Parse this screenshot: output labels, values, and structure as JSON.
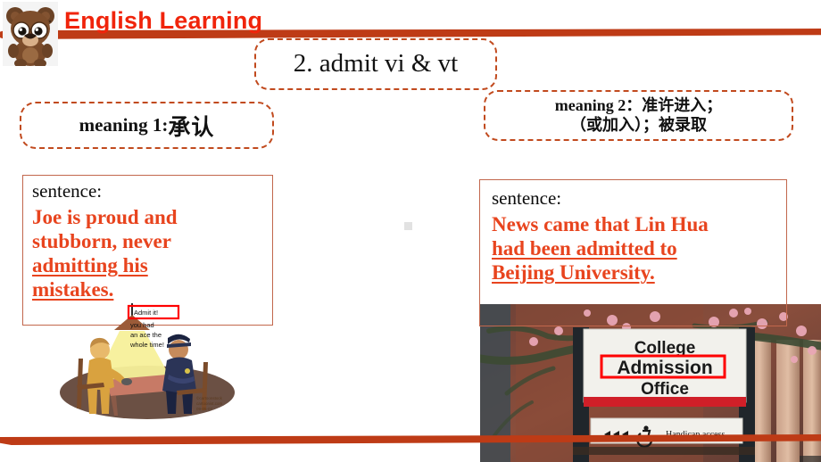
{
  "brand": {
    "title": "English Learning",
    "mascot_icon": "bear-mascot-icon"
  },
  "title_box": {
    "text": "2. admit vi & vt"
  },
  "meaning1_box": {
    "label": "meaning 1: ",
    "chinese": "承认"
  },
  "meaning2_box": {
    "line1": "meaning 2：准许进入；",
    "line2": "（或加入）；被录取"
  },
  "sentence_left": {
    "label": "sentence:",
    "line1": "Joe is proud and",
    "line2": "stubborn, never",
    "line3_underlined": "admitting his",
    "line4_underlined": "mistakes."
  },
  "sentence_right": {
    "label": "sentence:",
    "line1": "News came that Lin Hua",
    "line2_underlined": "had  been admitted to",
    "line3_underlined": "Beijing University."
  },
  "cartoon": {
    "name": "interrogation-cartoon",
    "caption_line1": "Admit it!",
    "caption_line2": "you had",
    "caption_line3": "an ace the",
    "caption_line4": "whole time!",
    "credit": "cartoon credit"
  },
  "photo": {
    "name": "college-admission-office-photo",
    "sign_line1": "College",
    "sign_line2_highlighted": "Admission",
    "sign_line3": "Office",
    "sub_sign": "Handicap access"
  },
  "colors": {
    "accent_bar": "#BE3B16",
    "brand_red": "#F0240B",
    "dashed_border": "#C14A1E",
    "sentence_border": "#C2674C",
    "sentence_text": "#E8441E",
    "highlight_box": "#FF0000"
  }
}
